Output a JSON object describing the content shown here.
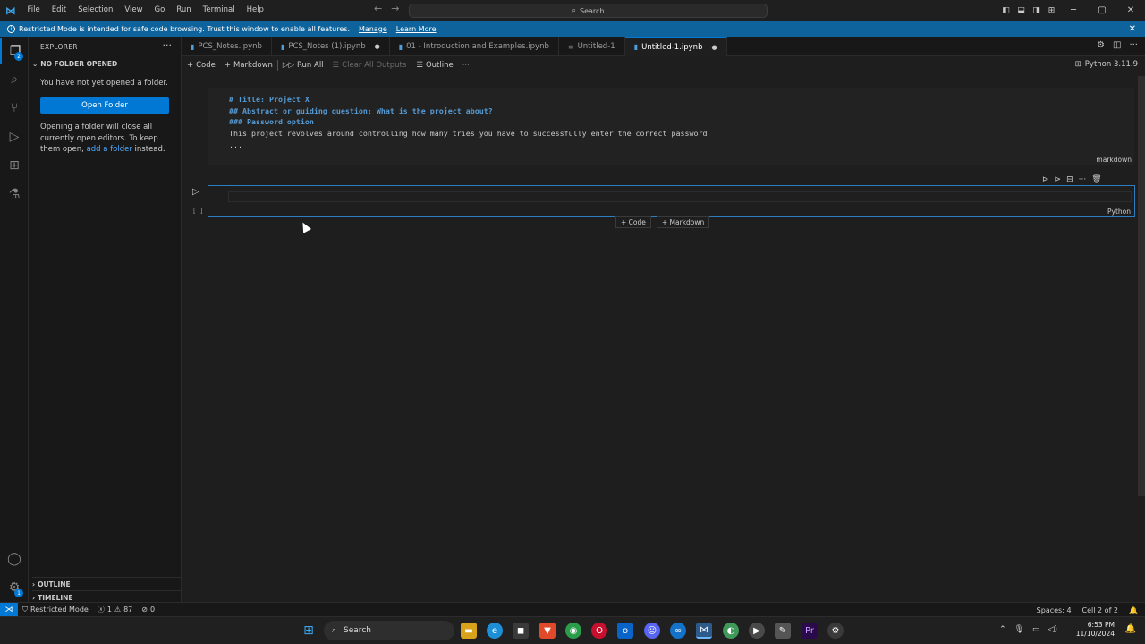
{
  "menu": [
    "File",
    "Edit",
    "Selection",
    "View",
    "Go",
    "Run",
    "Terminal",
    "Help"
  ],
  "command_search": "Search",
  "banner": {
    "text": "Restricted Mode is intended for safe code browsing. Trust this window to enable all features.",
    "manage": "Manage",
    "learn_more": "Learn More"
  },
  "activity": {
    "explorer_badge": "2",
    "settings_badge": "1"
  },
  "sidebar": {
    "title": "EXPLORER",
    "section": "NO FOLDER OPENED",
    "message": "You have not yet opened a folder.",
    "open_folder": "Open Folder",
    "note_before": "Opening a folder will close all currently open editors. To keep them open, ",
    "note_link": "add a folder",
    "note_after": " instead.",
    "outline": "OUTLINE",
    "timeline": "TIMELINE"
  },
  "tabs": [
    {
      "label": "PCS_Notes.ipynb",
      "dirty": false
    },
    {
      "label": "PCS_Notes (1).ipynb",
      "dirty": true
    },
    {
      "label": "01 - Introduction and Examples.ipynb",
      "dirty": false
    },
    {
      "label": "Untitled-1",
      "dirty": false
    },
    {
      "label": "Untitled-1.ipynb",
      "dirty": true,
      "active": true
    }
  ],
  "toolbar": {
    "code": "Code",
    "markdown": "Markdown",
    "run_all": "Run All",
    "clear_outputs": "Clear All Outputs",
    "outline": "Outline",
    "kernel": "Python 3.11.9"
  },
  "cells": [
    {
      "type": "markdown",
      "lines": [
        "# Title: Project X",
        "## Abstract or guiding question: What is the project about?",
        "### Password option",
        "This project revolves around controlling how many tries you have to successfully enter the correct password",
        "..."
      ],
      "language": "markdown"
    },
    {
      "type": "code",
      "exec_count": "[ ]",
      "language": "Python"
    }
  ],
  "add_cell": {
    "code": "Code",
    "markdown": "Markdown"
  },
  "status": {
    "mode": "Restricted Mode",
    "errors": "1",
    "warnings": "87",
    "ports": "0",
    "spaces": "Spaces: 4",
    "cell": "Cell 2 of 2"
  },
  "taskbar": {
    "search": "Search",
    "time": "6:53 PM",
    "date": "11/10/2024"
  }
}
